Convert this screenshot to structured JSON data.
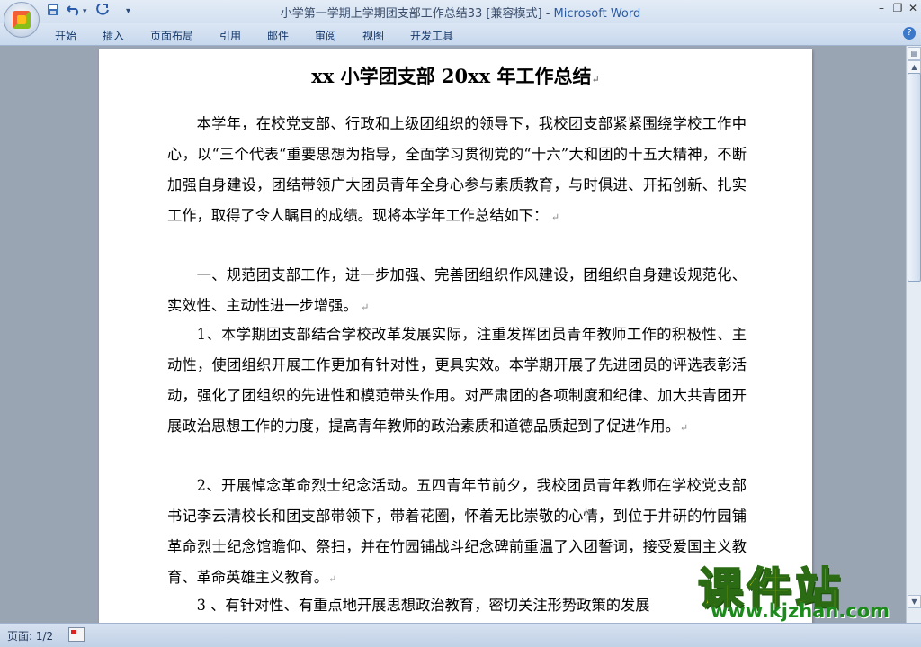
{
  "window": {
    "title": "小学第一学期上学期团支部工作总结33 [兼容模式] - ",
    "app_name": "Microsoft Word",
    "controls": {
      "minimize": "–",
      "restore": "❐",
      "close": "✕"
    }
  },
  "quick_access": {
    "save_icon": "save-icon",
    "undo_icon": "undo-icon",
    "redo_icon": "redo-icon",
    "customize": "▾"
  },
  "ribbon": {
    "tabs": [
      "开始",
      "插入",
      "页面布局",
      "引用",
      "邮件",
      "审阅",
      "视图",
      "开发工具"
    ],
    "help": "?"
  },
  "document": {
    "title": "xx 小学团支部 20xx 年工作总结",
    "paragraphs": [
      "本学年，在校党支部、行政和上级团组织的领导下，我校团支部紧紧围绕学校工作中心，以“三个代表“重要思想为指导，全面学习贯彻党的“十六”大和团的十五大精神，不断加强自身建设，团结带领广大团员青年全身心参与素质教育，与时俱进、开拓创新、扎实工作，取得了令人瞩目的成绩。现将本学年工作总结如下：",
      "一、规范团支部工作，进一步加强、完善团组织作风建设，团组织自身建设规范化、实效性、主动性进一步增强。",
      "1、本学期团支部结合学校改革发展实际，注重发挥团员青年教师工作的积极性、主动性，使团组织开展工作更加有针对性，更具实效。本学期开展了先进团员的评选表彰活动，强化了团组织的先进性和模范带头作用。对严肃团的各项制度和纪律、加大共青团开展政治思想工作的力度，提高青年教师的政治素质和道德品质起到了促进作用。",
      "2、开展悼念革命烈士纪念活动。五四青年节前夕，我校团员青年教师在学校党支部书记李云清校长和团支部带领下，带着花圈，怀着无比崇敬的心情，到位于井研的竹园铺革命烈士纪念馆瞻仰、祭扫，并在竹园铺战斗纪念碑前重温了入团誓词，接受爱国主义教育、革命英雄主义教育。",
      "3 、有针对性、有重点地开展思想政治教育，密切关注形势政策的发展"
    ],
    "paragraph_mark": "↵"
  },
  "status": {
    "page": "页面: 1/2"
  },
  "watermark": {
    "text": "课件站",
    "url": "www.kjzhan.com"
  }
}
